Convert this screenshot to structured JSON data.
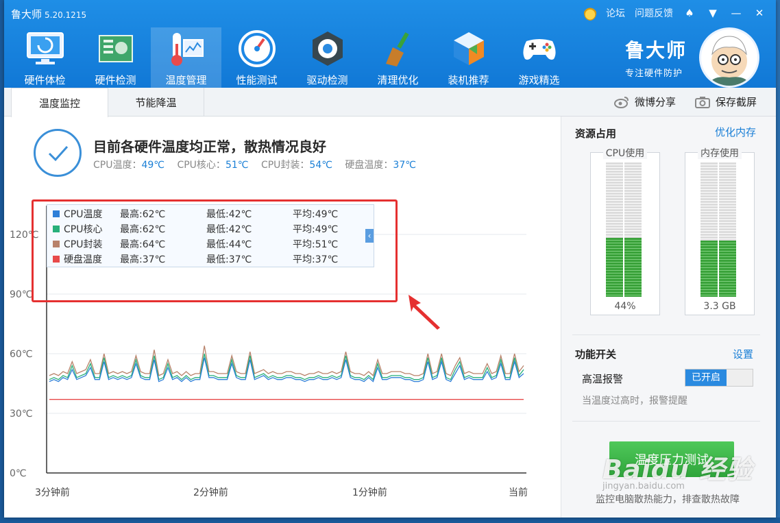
{
  "app": {
    "name": "鲁大师",
    "version": "5.20.1215"
  },
  "topbar": {
    "forum": "论坛",
    "feedback": "问题反馈",
    "icons": [
      "medal-icon",
      "skin-icon",
      "menu-icon",
      "minimize-icon",
      "close-icon"
    ]
  },
  "nav": [
    {
      "label": "硬件体检",
      "icon": "monitor-icon"
    },
    {
      "label": "硬件检测",
      "icon": "board-icon"
    },
    {
      "label": "温度管理",
      "icon": "thermometer-icon"
    },
    {
      "label": "性能测试",
      "icon": "gauge-icon"
    },
    {
      "label": "驱动检测",
      "icon": "gear-icon"
    },
    {
      "label": "清理优化",
      "icon": "broom-icon"
    },
    {
      "label": "装机推荐",
      "icon": "cube-icon"
    },
    {
      "label": "游戏精选",
      "icon": "gamepad-icon"
    }
  ],
  "brand": {
    "name": "鲁大师",
    "slogan": "专注硬件防护"
  },
  "tabs": {
    "t1": "温度监控",
    "t2": "节能降温"
  },
  "actions": {
    "weibo": "微博分享",
    "screenshot": "保存截屏"
  },
  "status": {
    "title": "目前各硬件温度均正常，散热情况良好",
    "items": [
      {
        "label": "CPU温度：",
        "value": "49℃"
      },
      {
        "label": "CPU核心：",
        "value": "51℃"
      },
      {
        "label": "CPU封装：",
        "value": "54℃"
      },
      {
        "label": "硬盘温度：",
        "value": "37℃"
      }
    ]
  },
  "legend": [
    {
      "name": "CPU温度",
      "max": "最高:62℃",
      "min": "最低:42℃",
      "avg": "平均:49℃",
      "color": "#2e7fd8"
    },
    {
      "name": "CPU核心",
      "max": "最高:62℃",
      "min": "最低:42℃",
      "avg": "平均:49℃",
      "color": "#27b07a"
    },
    {
      "name": "CPU封装",
      "max": "最高:64℃",
      "min": "最低:44℃",
      "avg": "平均:51℃",
      "color": "#b8826a"
    },
    {
      "name": "硬盘温度",
      "max": "最高:37℃",
      "min": "最低:37℃",
      "avg": "平均:37℃",
      "color": "#e84a4a"
    }
  ],
  "chart_data": {
    "type": "line",
    "y_ticks": [
      "0℃",
      "30℃",
      "60℃",
      "90℃",
      "120℃"
    ],
    "x_ticks": [
      "3分钟前",
      "2分钟前",
      "1分钟前",
      "当前"
    ],
    "ylim": [
      0,
      120
    ],
    "series": [
      {
        "name": "CPU温度",
        "color": "#2e7fd8",
        "values": [
          46,
          47,
          46,
          48,
          47,
          52,
          47,
          48,
          49,
          53,
          47,
          47,
          56,
          47,
          48,
          47,
          48,
          47,
          48,
          55,
          48,
          47,
          47,
          57,
          46,
          47,
          53,
          47,
          48,
          46,
          48,
          46,
          47,
          47,
          58,
          48,
          48,
          47,
          47,
          47,
          55,
          48,
          47,
          47,
          57,
          47,
          48,
          49,
          47,
          48,
          47,
          47,
          48,
          48,
          47,
          47,
          46,
          47,
          47,
          48,
          47,
          47,
          48,
          47,
          48,
          57,
          48,
          47,
          47,
          46,
          48,
          46,
          53,
          47,
          47,
          48,
          48,
          48,
          47,
          47,
          46,
          46,
          47,
          56,
          47,
          48,
          56,
          47,
          46,
          50,
          54,
          47,
          48,
          47,
          47,
          47,
          51,
          47,
          48,
          55,
          47,
          47,
          56,
          48,
          50
        ]
      },
      {
        "name": "CPU核心",
        "color": "#27b07a",
        "values": [
          47,
          48,
          47,
          49,
          48,
          54,
          48,
          49,
          50,
          55,
          48,
          48,
          58,
          48,
          49,
          48,
          49,
          48,
          49,
          57,
          49,
          48,
          48,
          59,
          47,
          48,
          55,
          48,
          49,
          47,
          49,
          47,
          48,
          48,
          60,
          49,
          49,
          48,
          48,
          48,
          57,
          49,
          48,
          48,
          59,
          48,
          49,
          50,
          48,
          49,
          48,
          48,
          49,
          49,
          48,
          48,
          47,
          48,
          48,
          49,
          48,
          48,
          49,
          48,
          49,
          59,
          49,
          48,
          48,
          47,
          49,
          47,
          55,
          48,
          48,
          49,
          49,
          49,
          48,
          48,
          47,
          47,
          48,
          58,
          48,
          49,
          58,
          48,
          47,
          52,
          56,
          48,
          49,
          48,
          48,
          48,
          53,
          48,
          49,
          57,
          48,
          48,
          58,
          49,
          52
        ]
      },
      {
        "name": "CPU封装",
        "color": "#b8826a",
        "values": [
          49,
          50,
          49,
          51,
          50,
          56,
          50,
          51,
          52,
          57,
          50,
          50,
          60,
          50,
          51,
          50,
          51,
          50,
          51,
          59,
          51,
          50,
          50,
          62,
          49,
          50,
          57,
          50,
          51,
          49,
          51,
          49,
          50,
          50,
          64,
          51,
          51,
          50,
          50,
          50,
          59,
          51,
          50,
          50,
          61,
          50,
          51,
          52,
          50,
          51,
          50,
          50,
          51,
          51,
          50,
          50,
          49,
          50,
          50,
          51,
          50,
          50,
          51,
          50,
          51,
          61,
          51,
          50,
          50,
          49,
          51,
          49,
          57,
          50,
          50,
          51,
          51,
          51,
          50,
          50,
          49,
          49,
          50,
          60,
          50,
          51,
          60,
          50,
          49,
          54,
          58,
          50,
          51,
          50,
          50,
          50,
          55,
          50,
          51,
          59,
          50,
          50,
          60,
          51,
          54
        ]
      },
      {
        "name": "硬盘温度",
        "color": "#e84a4a",
        "values": [
          37,
          37
        ]
      }
    ]
  },
  "resources": {
    "title": "资源占用",
    "link": "优化内存",
    "cpu": {
      "label": "CPU使用",
      "value": "44%",
      "percent": 44
    },
    "mem": {
      "label": "内存使用",
      "value": "3.3 GB",
      "percent": 42
    }
  },
  "features": {
    "title": "功能开关",
    "link": "设置",
    "alarm_label": "高温报警",
    "toggle_on": "已开启",
    "hint": "当温度过高时，报警提醒"
  },
  "stress": {
    "button": "温度压力测试",
    "hint": "监控电脑散热能力，排查散热故障"
  },
  "watermark": {
    "text": "Baidu 经验",
    "url": "jingyan.baidu.com"
  }
}
